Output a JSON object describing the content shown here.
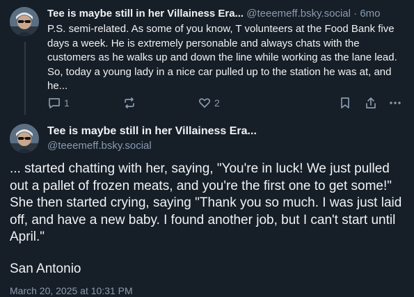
{
  "reply_parent": {
    "author_name": "Tee is maybe still in her Villainess Era...",
    "author_handle": "@teeemeff.bsky.social",
    "separator": "·",
    "age": "6mo",
    "text": "P.S. semi-related. As some of you know, T volunteers at the Food Bank five days a week. He is extremely personable and always chats with the customers as he walks up and down the line while working as the lane lead. So, today a young lady in a nice car pulled up to the station he was at, and he...",
    "actions": {
      "reply_count": "1",
      "repost_count": "",
      "like_count": "2"
    }
  },
  "main_post": {
    "author_name": "Tee is maybe still in her Villainess Era...",
    "author_handle": "@teeemeff.bsky.social",
    "text": "... started chatting with her, saying, \"You're in luck! We just pulled out a pallet of frozen meats, and you're the first one to get some!\" She then started crying, saying \"Thank you so much. I was just laid off, and have a new baby. I found another job, but I can't start until April.\"",
    "location": "San Antonio",
    "timestamp": "March 20, 2025 at 10:31 PM"
  },
  "colors": {
    "background": "#161e27",
    "text": "#f1f3f5",
    "muted": "#8a9bb0"
  },
  "icons": [
    "reply-icon",
    "repost-icon",
    "like-icon",
    "bookmark-icon",
    "share-icon",
    "more-icon"
  ]
}
